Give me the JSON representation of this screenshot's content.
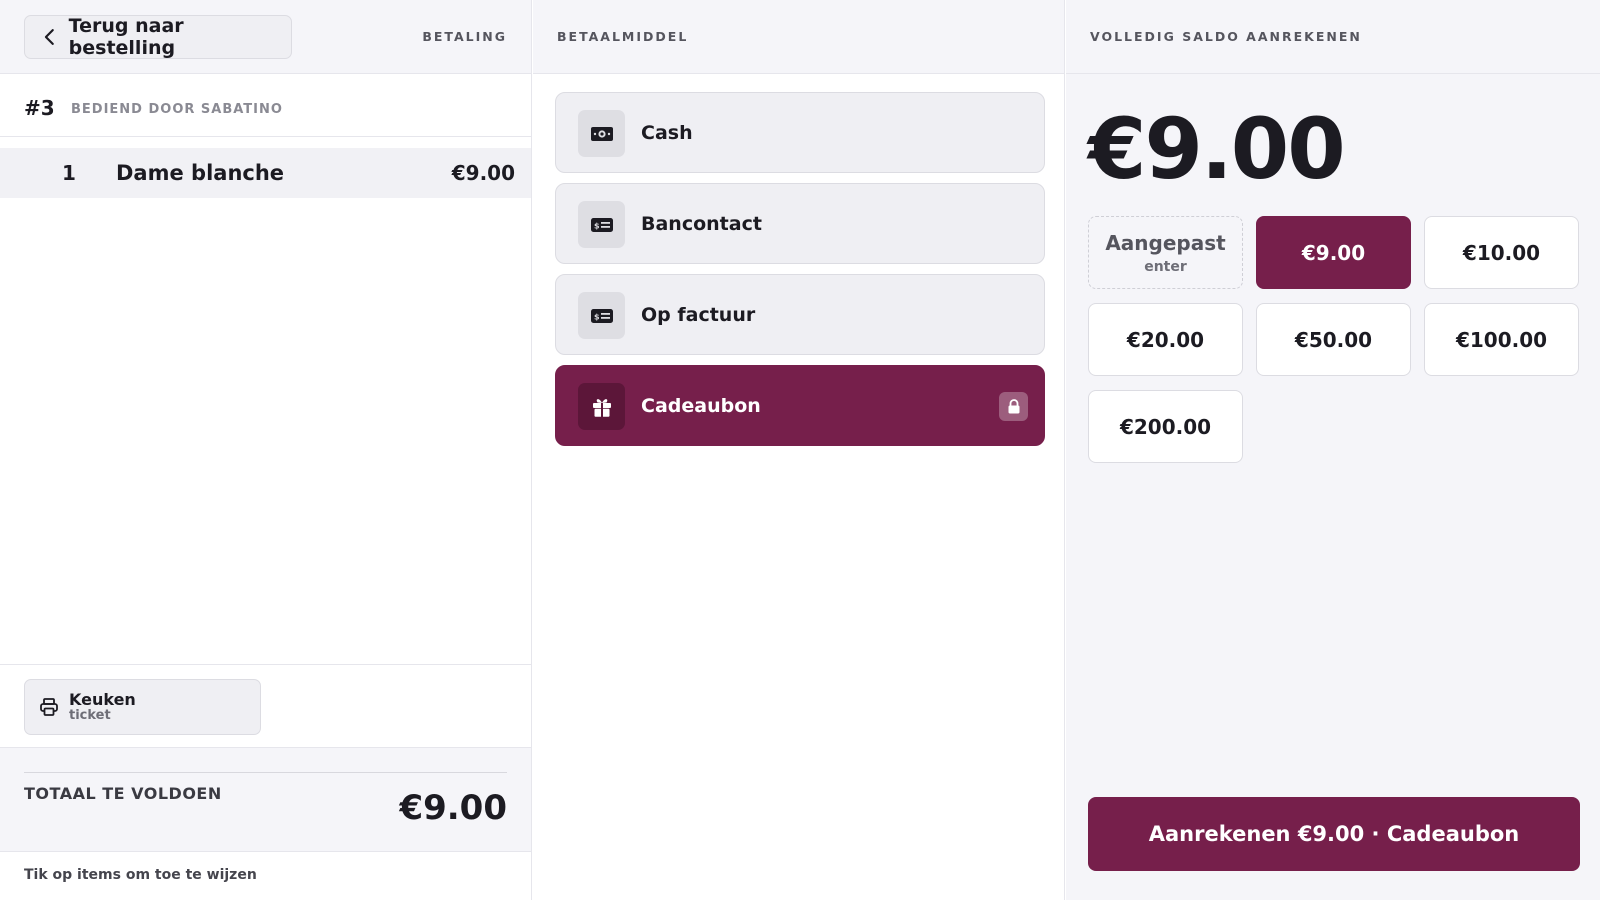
{
  "left": {
    "back_label": "Terug naar bestelling",
    "section_label": "BETALING",
    "order_number": "#3",
    "served_by": "BEDIEND DOOR SABATINO",
    "items": [
      {
        "qty": "1",
        "name": "Dame blanche",
        "price": "€9.00"
      }
    ],
    "printer": {
      "title": "Keuken",
      "subtitle": "ticket"
    },
    "total_label": "TOTAAL TE VOLDOEN",
    "total_value": "€9.00",
    "hint": "Tik op items om toe te wijzen"
  },
  "middle": {
    "section_label": "BETAALMIDDEL",
    "methods": [
      {
        "label": "Cash",
        "icon": "cash-icon"
      },
      {
        "label": "Bancontact",
        "icon": "card-icon"
      },
      {
        "label": "Op factuur",
        "icon": "invoice-icon"
      },
      {
        "label": "Cadeaubon",
        "icon": "gift-icon",
        "selected": true,
        "locked": true
      }
    ]
  },
  "right": {
    "section_label": "VOLLEDIG SALDO AANREKENEN",
    "amount": "€9.00",
    "custom": {
      "label": "Aangepast",
      "sub": "enter"
    },
    "presets": [
      "€9.00",
      "€10.00",
      "€20.00",
      "€50.00",
      "€100.00",
      "€200.00"
    ],
    "selected_preset": "€9.00",
    "charge_label": "Aanrekenen €9.00 · Cadeaubon"
  },
  "colors": {
    "accent": "#761f4b",
    "panel": "#f5f5f9"
  }
}
